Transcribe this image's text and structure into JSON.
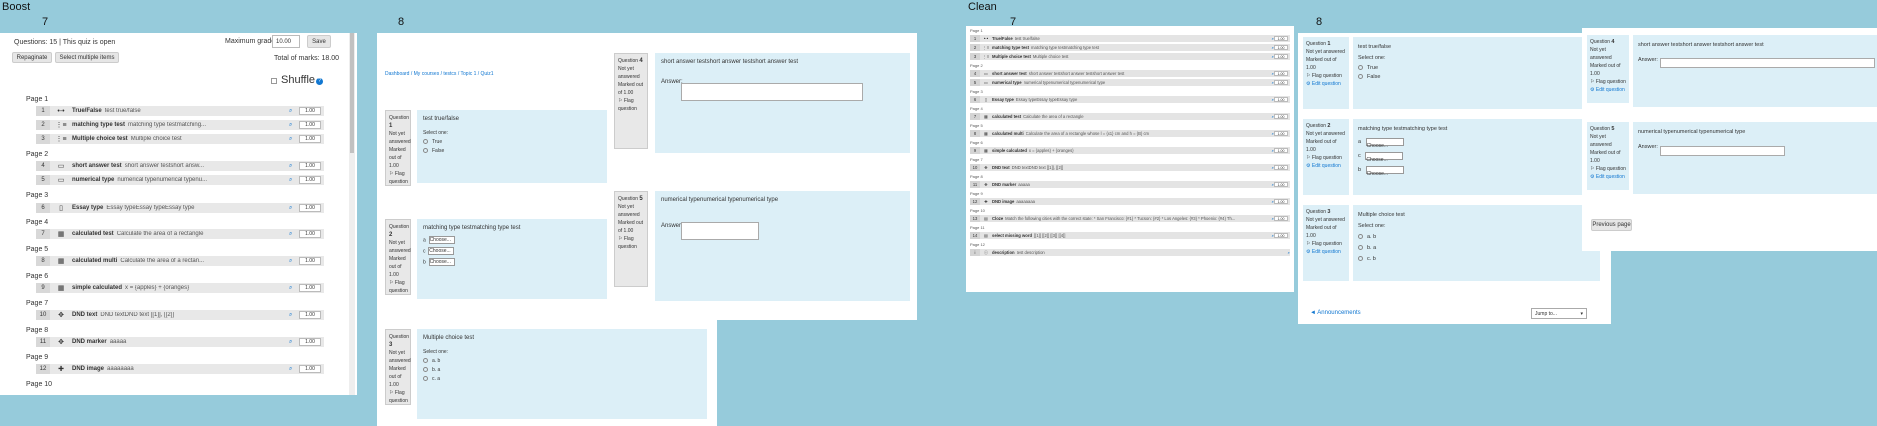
{
  "labels": {
    "boost": "Boost",
    "clean": "Clean",
    "n7a": "7",
    "n8a": "8",
    "n7b": "7",
    "n8b": "8"
  },
  "boost_edit": {
    "questions_status": "Questions: 15 | This quiz is open",
    "maxgrade_label": "Maximum grade",
    "maxgrade_value": "10.00",
    "save": "Save",
    "repaginate": "Repaginate",
    "select_multiple": "Select multiple items",
    "total_marks": "Total of marks: 18.00",
    "shuffle": "Shuffle",
    "pages": [
      "Page 1",
      "Page 2",
      "Page 3",
      "Page 4",
      "Page 5",
      "Page 6",
      "Page 7",
      "Page 8",
      "Page 9",
      "Page 10"
    ],
    "rows": [
      {
        "num": "1",
        "icon": "•-•",
        "name": "True/False",
        "text": "test true/false",
        "mark": "1.00"
      },
      {
        "num": "2",
        "icon": "⋮≡",
        "name": "matching type test",
        "text": "matching type testmatching...",
        "mark": "1.00"
      },
      {
        "num": "3",
        "icon": "⋮≡",
        "name": "Multiple choice test",
        "text": "Multiple choice test",
        "mark": "1.00"
      },
      {
        "num": "4",
        "icon": "▭",
        "name": "short answer test",
        "text": "short answer testshort answ...",
        "mark": "1.00"
      },
      {
        "num": "5",
        "icon": "▭",
        "name": "numerical type",
        "text": "numerical typenumerical typenu...",
        "mark": "1.00"
      },
      {
        "num": "6",
        "icon": "▯",
        "name": "Essay type",
        "text": "Essay typeEssay typeEssay type",
        "mark": "1.00"
      },
      {
        "num": "7",
        "icon": "▦",
        "name": "calculated test",
        "text": "Calculate the area of a rectangle",
        "mark": "1.00"
      },
      {
        "num": "8",
        "icon": "▦",
        "name": "calculated multi",
        "text": "Calculate the area of a rectan...",
        "mark": "1.00"
      },
      {
        "num": "9",
        "icon": "▦",
        "name": "simple calculated",
        "text": "x = {apples} + {oranges}",
        "mark": "1.00"
      },
      {
        "num": "10",
        "icon": "✥",
        "name": "DND text",
        "text": "DND textDND text [[1]], [[2]]",
        "mark": "1.00"
      },
      {
        "num": "11",
        "icon": "✥",
        "name": "DND marker",
        "text": "aaaaa",
        "mark": "1.00"
      },
      {
        "num": "12",
        "icon": "✚",
        "name": "DND image",
        "text": "aaaaaaaa",
        "mark": "1.00"
      }
    ]
  },
  "boost_attempt": {
    "breadcrumb": [
      "Dashboard",
      "My courses",
      "testcs",
      "Topic 1",
      "Quiz1"
    ],
    "q1": {
      "label": "Question",
      "num": "1",
      "status": "Not yet answered",
      "marked": "Marked out of 1.00",
      "flag": "Flag question",
      "text": "test true/false",
      "select": "Select one:",
      "opts": [
        "True",
        "False"
      ]
    },
    "q2": {
      "label": "Question",
      "num": "2",
      "status": "Not yet answered",
      "marked": "Marked out of 1.00",
      "flag": "Flag question",
      "text": "matching type testmatching type test",
      "rows": [
        "a",
        "c",
        "b"
      ],
      "choose": "Choose..."
    },
    "q3": {
      "label": "Question",
      "num": "3",
      "status": "Not yet answered",
      "marked": "Marked out of 1.00",
      "flag": "Flag question",
      "text": "Multiple choice test",
      "select": "Select one:",
      "opts": [
        "a. b",
        "b. a",
        "c. a"
      ]
    },
    "q4": {
      "label": "Question",
      "num": "4",
      "status": "Not yet answered",
      "marked": "Marked out of 1.00",
      "flag": "Flag question",
      "text": "short answer testshort answer testshort answer test",
      "answer": "Answer:"
    },
    "q5": {
      "label": "Question",
      "num": "5",
      "status": "Not yet answered",
      "marked": "Marked out of 1.00",
      "flag": "Flag question",
      "text": "numerical typenumerical typenumerical type",
      "answer": "Answer:"
    }
  },
  "clean_edit": {
    "pages": [
      "Page 1",
      "Page 2",
      "Page 3",
      "Page 4",
      "Page 5",
      "Page 6",
      "Page 7",
      "Page 8",
      "Page 9",
      "Page 10",
      "Page 11",
      "Page 12"
    ],
    "rows": [
      {
        "num": "1",
        "name": "True/False",
        "text": "test true/false",
        "mark": "1.00"
      },
      {
        "num": "2",
        "name": "matching type test",
        "text": "matching type testmatching type test",
        "mark": "1.00"
      },
      {
        "num": "3",
        "name": "Multiple choice test",
        "text": "Multiple choice test",
        "mark": "1.00"
      },
      {
        "num": "4",
        "name": "short answer test",
        "text": "short answer testshort answer testshort answer test",
        "mark": "1.00"
      },
      {
        "num": "5",
        "name": "numerical type",
        "text": "numerical typenumerical typenumerical type",
        "mark": "1.00"
      },
      {
        "num": "6",
        "name": "Essay type",
        "text": "Essay typeEssay typeEssay type",
        "mark": "1.00"
      },
      {
        "num": "7",
        "name": "calculated test",
        "text": "Calculate the area of a rectangle",
        "mark": "1.00"
      },
      {
        "num": "8",
        "name": "calculated multi",
        "text": "Calculate the area of a rectangle whose l = {x1} cm and h = {B} cm",
        "mark": "1.00"
      },
      {
        "num": "9",
        "name": "simple calculated",
        "text": "x = {apples} + {oranges}",
        "mark": "1.00"
      },
      {
        "num": "10",
        "name": "DND text",
        "text": "DND textDND text [[1]], [[2]]",
        "mark": "1.00"
      },
      {
        "num": "11",
        "name": "DND marker",
        "text": "aaaaa",
        "mark": "1.00"
      },
      {
        "num": "12",
        "name": "DND image",
        "text": "aaaaaaaa",
        "mark": "1.00"
      },
      {
        "num": "13",
        "name": "Cloze",
        "text": "Match the following cities with the correct state: * San Francisco: {#1} * Tucson: {#2} * Los Angeles: {#3} * Phoenix: {#4} Th...",
        "mark": "1.00"
      },
      {
        "num": "14",
        "name": "select missing word",
        "text": "[[1]] [[2]] [[3]] [[4]]",
        "mark": "1.00"
      },
      {
        "num": "i",
        "name": "description",
        "text": "test description",
        "mark": ""
      }
    ]
  },
  "clean_attempt": {
    "q1": {
      "label": "Question",
      "num": "1",
      "status": "Not yet answered",
      "marked": "Marked out of 1.00",
      "flag": "Flag question",
      "edit": "Edit question",
      "text": "test true/false",
      "select": "Select one:",
      "opts": [
        "True",
        "False"
      ]
    },
    "q2": {
      "label": "Question",
      "num": "2",
      "status": "Not yet answered",
      "marked": "Marked out of 1.00",
      "flag": "Flag question",
      "edit": "Edit question",
      "text": "matching type testmatching type test",
      "rows": [
        "a",
        "c",
        "b"
      ],
      "choose": "Choose..."
    },
    "q3": {
      "label": "Question",
      "num": "3",
      "status": "Not yet answered",
      "marked": "Marked out of 1.00",
      "flag": "Flag question",
      "edit": "Edit question",
      "text": "Multiple choice test",
      "select": "Select one:",
      "opts": [
        "a. b",
        "b. a",
        "c. b"
      ]
    },
    "q4": {
      "label": "Question",
      "num": "4",
      "status": "Not yet answered",
      "marked": "Marked out of 1.00",
      "flag": "Flag question",
      "edit": "Edit question",
      "text": "short answer testshort answer testshort answer test",
      "answer": "Answer:"
    },
    "q5": {
      "label": "Question",
      "num": "5",
      "status": "Not yet answered",
      "marked": "Marked out of 1.00",
      "flag": "Flag question",
      "edit": "Edit question",
      "text": "numerical typenumerical typenumerical type",
      "answer": "Answer:"
    },
    "prev_page": "Previous page",
    "announcements": "◄ Announcements",
    "jump_to": "Jump to..."
  }
}
